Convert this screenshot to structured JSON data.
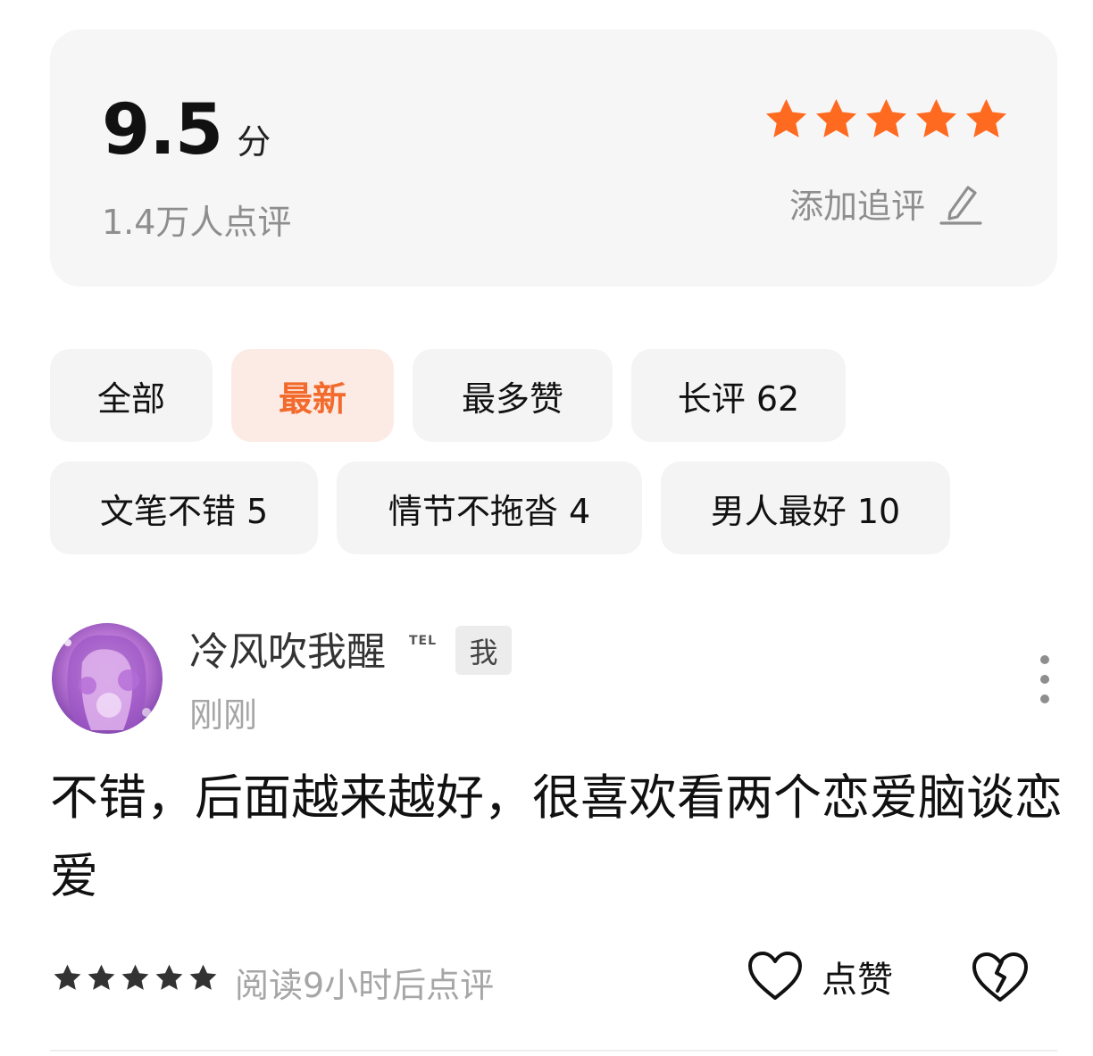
{
  "rating": {
    "score": "9.5",
    "unit": "分",
    "review_count": "1.4万人点评",
    "stars": 5,
    "star_color": "#ff6a21",
    "add_followup_label": "添加追评"
  },
  "filters": [
    {
      "label": "全部",
      "active": false
    },
    {
      "label": "最新",
      "active": true
    },
    {
      "label": "最多赞",
      "active": false
    },
    {
      "label": "长评 62",
      "active": false
    },
    {
      "label": "文笔不错 5",
      "active": false
    },
    {
      "label": "情节不拖沓 4",
      "active": false
    },
    {
      "label": "男人最好 10",
      "active": false
    }
  ],
  "review": {
    "username": "冷风吹我醒",
    "level_badge": "TEL",
    "me_badge": "我",
    "time": "刚刚",
    "text": "不错，后面越来越好，很喜欢看两个恋爱脑谈恋爱",
    "stars": 5,
    "read_note": "阅读9小时后点评",
    "like_label": "点赞"
  },
  "colors": {
    "accent": "#f26b2d",
    "active_chip_bg": "#fcebe5",
    "card_bg": "#f6f6f6",
    "muted_text": "#8e8e8e"
  },
  "icons": [
    "star-icon",
    "pencil-icon",
    "more-vertical-icon",
    "heart-icon",
    "broken-heart-icon"
  ]
}
